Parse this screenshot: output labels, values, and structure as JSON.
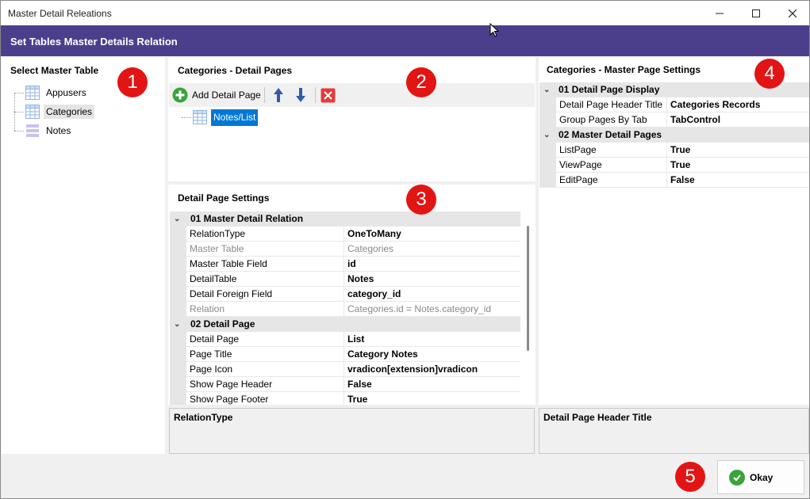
{
  "window": {
    "title": "Master Detail Releations"
  },
  "header": {
    "title": "Set Tables Master Details Relation"
  },
  "master_panel": {
    "title": "Select Master Table",
    "items": [
      {
        "label": "Appusers"
      },
      {
        "label": "Categories"
      },
      {
        "label": "Notes"
      }
    ]
  },
  "detail_pages": {
    "title": "Categories - Detail Pages",
    "add_label": "Add Detail Page",
    "items": [
      {
        "label": "Notes/List"
      }
    ]
  },
  "detail_settings": {
    "title": "Detail Page Settings",
    "categories": [
      {
        "name": "01 Master Detail Relation",
        "rows": [
          {
            "name": "RelationType",
            "value": "OneToMany"
          },
          {
            "name": "Master Table",
            "value": "Categories"
          },
          {
            "name": "Master Table Field",
            "value": "id"
          },
          {
            "name": "DetailTable",
            "value": "Notes"
          },
          {
            "name": "Detail Foreign Field",
            "value": "category_id"
          },
          {
            "name": "Relation",
            "value": "Categories.id = Notes.category_id"
          }
        ]
      },
      {
        "name": "02 Detail Page",
        "rows": [
          {
            "name": "Detail Page",
            "value": "List"
          },
          {
            "name": "Page Title",
            "value": "Category Notes"
          },
          {
            "name": "Page Icon",
            "value": "vradicon[extension]vradicon"
          },
          {
            "name": "Show Page Header",
            "value": "False"
          },
          {
            "name": "Show Page Footer",
            "value": "True"
          }
        ]
      }
    ],
    "description": "RelationType"
  },
  "master_settings": {
    "title": "Categories - Master Page Settings",
    "categories": [
      {
        "name": "01 Detail Page Display",
        "rows": [
          {
            "name": "Detail Page Header Title",
            "value": "Categories Records"
          },
          {
            "name": "Group Pages By Tab",
            "value": "TabControl"
          }
        ]
      },
      {
        "name": "02 Master Detail Pages",
        "rows": [
          {
            "name": "ListPage",
            "value": "True"
          },
          {
            "name": "ViewPage",
            "value": "True"
          },
          {
            "name": "EditPage",
            "value": "False"
          }
        ]
      }
    ],
    "description": "Detail Page Header Title"
  },
  "badges": [
    "1",
    "2",
    "3",
    "4",
    "5"
  ],
  "footer": {
    "okay_label": "Okay"
  },
  "colors": {
    "header_bg": "#4b3f8c",
    "badge": "#e21414",
    "selection": "#0078d7",
    "okay_check": "#3ba33b"
  }
}
